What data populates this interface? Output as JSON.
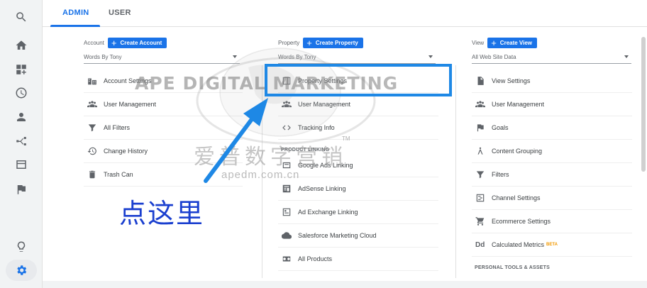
{
  "tabs": {
    "admin": "ADMIN",
    "user": "USER"
  },
  "rail": [
    "search-icon",
    "home-icon",
    "dashboard-icon",
    "clock-icon",
    "person-icon",
    "share-icon",
    "display-icon",
    "flag-icon",
    "lightbulb-icon",
    "gear-icon"
  ],
  "account": {
    "label": "Account",
    "create": "Create Account",
    "selected": "Words By Tony",
    "items": [
      {
        "label": "Account Settings",
        "icon": "building-icon"
      },
      {
        "label": "User Management",
        "icon": "people-icon"
      },
      {
        "label": "All Filters",
        "icon": "filter-icon"
      },
      {
        "label": "Change History",
        "icon": "history-icon"
      },
      {
        "label": "Trash Can",
        "icon": "trash-icon"
      }
    ]
  },
  "property": {
    "label": "Property",
    "create": "Create Property",
    "selected": "Words By Tony",
    "items": [
      {
        "label": "Property Settings",
        "icon": "property-icon"
      },
      {
        "label": "User Management",
        "icon": "people-icon"
      },
      {
        "label": "Tracking Info",
        "icon": "code-icon"
      }
    ],
    "section": "PRODUCT LINKING",
    "linking": [
      {
        "label": "Google Ads Linking",
        "icon": "ads-icon"
      },
      {
        "label": "AdSense Linking",
        "icon": "adsense-icon"
      },
      {
        "label": "Ad Exchange Linking",
        "icon": "adexchange-icon"
      },
      {
        "label": "Salesforce Marketing Cloud",
        "icon": "cloud-icon"
      },
      {
        "label": "All Products",
        "icon": "link-icon"
      }
    ]
  },
  "view": {
    "label": "View",
    "create": "Create View",
    "selected": "All Web Site Data",
    "items": [
      {
        "label": "View Settings",
        "icon": "document-icon"
      },
      {
        "label": "User Management",
        "icon": "people-icon"
      },
      {
        "label": "Goals",
        "icon": "flag-icon"
      },
      {
        "label": "Content Grouping",
        "icon": "grouping-icon"
      },
      {
        "label": "Filters",
        "icon": "filter-icon"
      },
      {
        "label": "Channel Settings",
        "icon": "channel-icon"
      },
      {
        "label": "Ecommerce Settings",
        "icon": "cart-icon"
      },
      {
        "label": "Calculated Metrics",
        "icon": "dd-icon",
        "badge": "BETA"
      }
    ],
    "section": "PERSONAL TOOLS & ASSETS"
  },
  "annotation": "点这里",
  "watermark": {
    "brand": "APE DIGITAL MARKETING",
    "chinese": "爱普数字营销",
    "url": "apedm.com.cn",
    "tm": "TM"
  },
  "colors": {
    "accent": "#1a73e8",
    "highlight": "#1e88e5",
    "annotation": "#1a3fcf"
  }
}
